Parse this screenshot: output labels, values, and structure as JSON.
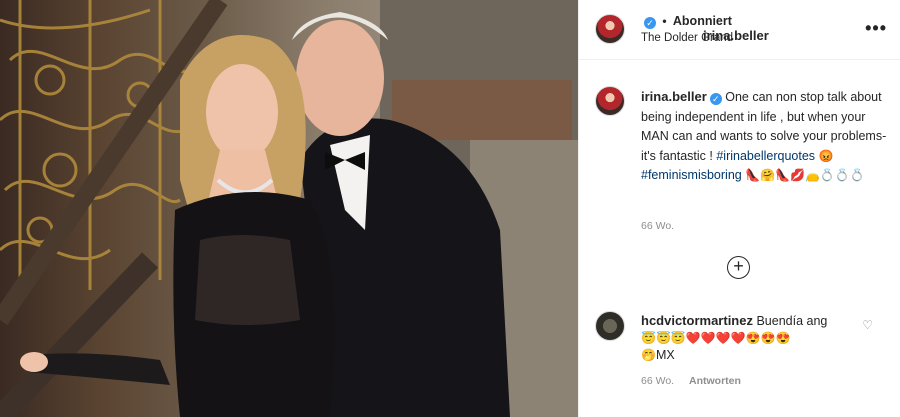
{
  "post": {
    "username": "irina.beller",
    "verified_mark": "✓",
    "separator": "•",
    "follow_state": "Abonniert",
    "location": "The Dolder Grand",
    "more_icon": "•••"
  },
  "caption": {
    "username": "irina.beller",
    "text": "One can non stop talk about being independent in life , but when your MAN can and wants to solve your problems- it's fantastic !",
    "hashtag1": "#irinabellerquotes",
    "emoji1": "😡",
    "hashtag2": "#feminismisboring",
    "emoji_row": "👠🤗👠💋👝💍💍💍",
    "time": "66 Wo."
  },
  "load_more_icon": "+",
  "comment": {
    "username": "hcdvictormartinez",
    "text": "Buendía ang",
    "emojis": "😇😇😇❤️❤️❤️❤️😍😍😍",
    "trailing_emoji": "🤭",
    "trailing_text": "MX",
    "time": "66 Wo.",
    "reply_label": "Antworten",
    "like_icon": "♡"
  },
  "colors": {
    "link": "#00376b",
    "verified": "#3897f0",
    "muted": "#8e8e8e"
  }
}
